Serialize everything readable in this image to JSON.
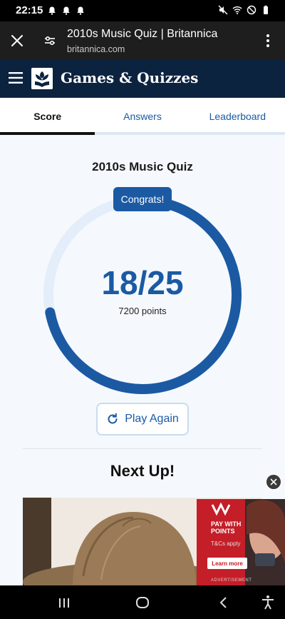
{
  "status_bar": {
    "time": "22:15",
    "left_icons": [
      "bell-icon",
      "bell-icon",
      "bell-icon"
    ],
    "right_icons": [
      "mute-icon",
      "wifi-icon",
      "do-not-disturb-icon",
      "battery-icon"
    ]
  },
  "browser": {
    "page_title": "2010s Music Quiz | Britannica",
    "domain": "britannica.com"
  },
  "site_header": {
    "title": "Games & Quizzes"
  },
  "tabs": [
    {
      "label": "Score",
      "active": true
    },
    {
      "label": "Answers",
      "active": false
    },
    {
      "label": "Leaderboard",
      "active": false
    }
  ],
  "result": {
    "quiz_title": "2010s Music Quiz",
    "badge": "Congrats!",
    "score_text": "18/25",
    "correct": 18,
    "total": 25,
    "points_text": "7200 points",
    "play_again_label": "Play Again"
  },
  "next_up": {
    "heading": "Next Up!"
  },
  "ad": {
    "headline_line1": "PAY WITH",
    "headline_line2": "POINTS",
    "subtext": "T&Cs apply",
    "cta": "Learn more",
    "label": "ADVERTISEMENT"
  },
  "colors": {
    "accent": "#1b5aa3",
    "ring_track": "#e3eefa",
    "header_bg": "#0c2340"
  }
}
